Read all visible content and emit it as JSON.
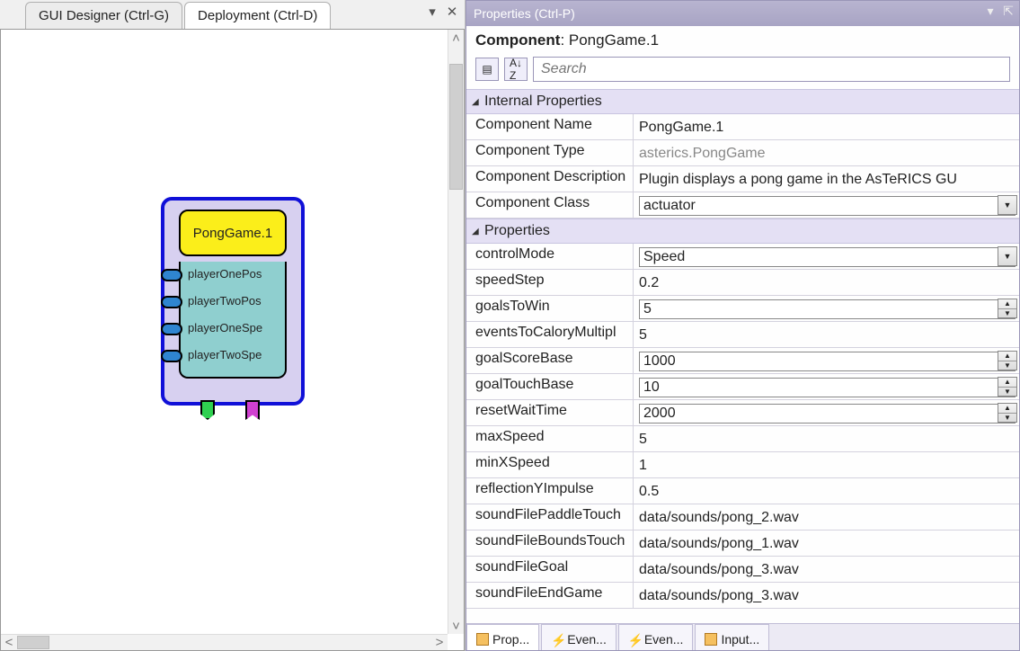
{
  "designer": {
    "tabs": [
      {
        "label": "GUI Designer (Ctrl-G)",
        "active": false
      },
      {
        "label": "Deployment (Ctrl-D)",
        "active": true
      }
    ],
    "node": {
      "title": "PongGame.1",
      "ports": [
        "playerOnePos",
        "playerTwoPos",
        "playerOneSpe",
        "playerTwoSpe"
      ]
    }
  },
  "properties": {
    "panelTitle": "Properties (Ctrl-P)",
    "componentLabel": "Component",
    "componentValue": "PongGame.1",
    "searchPlaceholder": "Search",
    "sections": {
      "internal": {
        "title": "Internal Properties",
        "rows": [
          {
            "key": "Component Name",
            "value": "PongGame.1",
            "type": "text"
          },
          {
            "key": "Component Type",
            "value": "asterics.PongGame",
            "type": "ro"
          },
          {
            "key": "Component Description",
            "value": "Plugin displays a pong game in the AsTeRICS GU",
            "type": "text"
          },
          {
            "key": "Component Class",
            "value": "actuator",
            "type": "combo"
          }
        ]
      },
      "props": {
        "title": "Properties",
        "rows": [
          {
            "key": "controlMode",
            "value": "Speed",
            "type": "combo"
          },
          {
            "key": "speedStep",
            "value": "0.2",
            "type": "text"
          },
          {
            "key": "goalsToWin",
            "value": "5",
            "type": "spinner"
          },
          {
            "key": "eventsToCaloryMultipl",
            "value": "5",
            "type": "text"
          },
          {
            "key": "goalScoreBase",
            "value": "1000",
            "type": "spinner"
          },
          {
            "key": "goalTouchBase",
            "value": "10",
            "type": "spinner"
          },
          {
            "key": "resetWaitTime",
            "value": "2000",
            "type": "spinner"
          },
          {
            "key": "maxSpeed",
            "value": "5",
            "type": "text"
          },
          {
            "key": "minXSpeed",
            "value": "1",
            "type": "text"
          },
          {
            "key": "reflectionYImpulse",
            "value": "0.5",
            "type": "text"
          },
          {
            "key": "soundFilePaddleTouch",
            "value": "data/sounds/pong_2.wav",
            "type": "text"
          },
          {
            "key": "soundFileBoundsTouch",
            "value": "data/sounds/pong_1.wav",
            "type": "text"
          },
          {
            "key": "soundFileGoal",
            "value": "data/sounds/pong_3.wav",
            "type": "text"
          },
          {
            "key": "soundFileEndGame",
            "value": "data/sounds/pong_3.wav",
            "type": "text"
          }
        ]
      }
    },
    "bottomTabs": [
      {
        "label": "Prop...",
        "icon": "prop",
        "active": true
      },
      {
        "label": "Even...",
        "icon": "event",
        "active": false
      },
      {
        "label": "Even...",
        "icon": "event",
        "active": false
      },
      {
        "label": "Input...",
        "icon": "input",
        "active": false
      }
    ]
  }
}
